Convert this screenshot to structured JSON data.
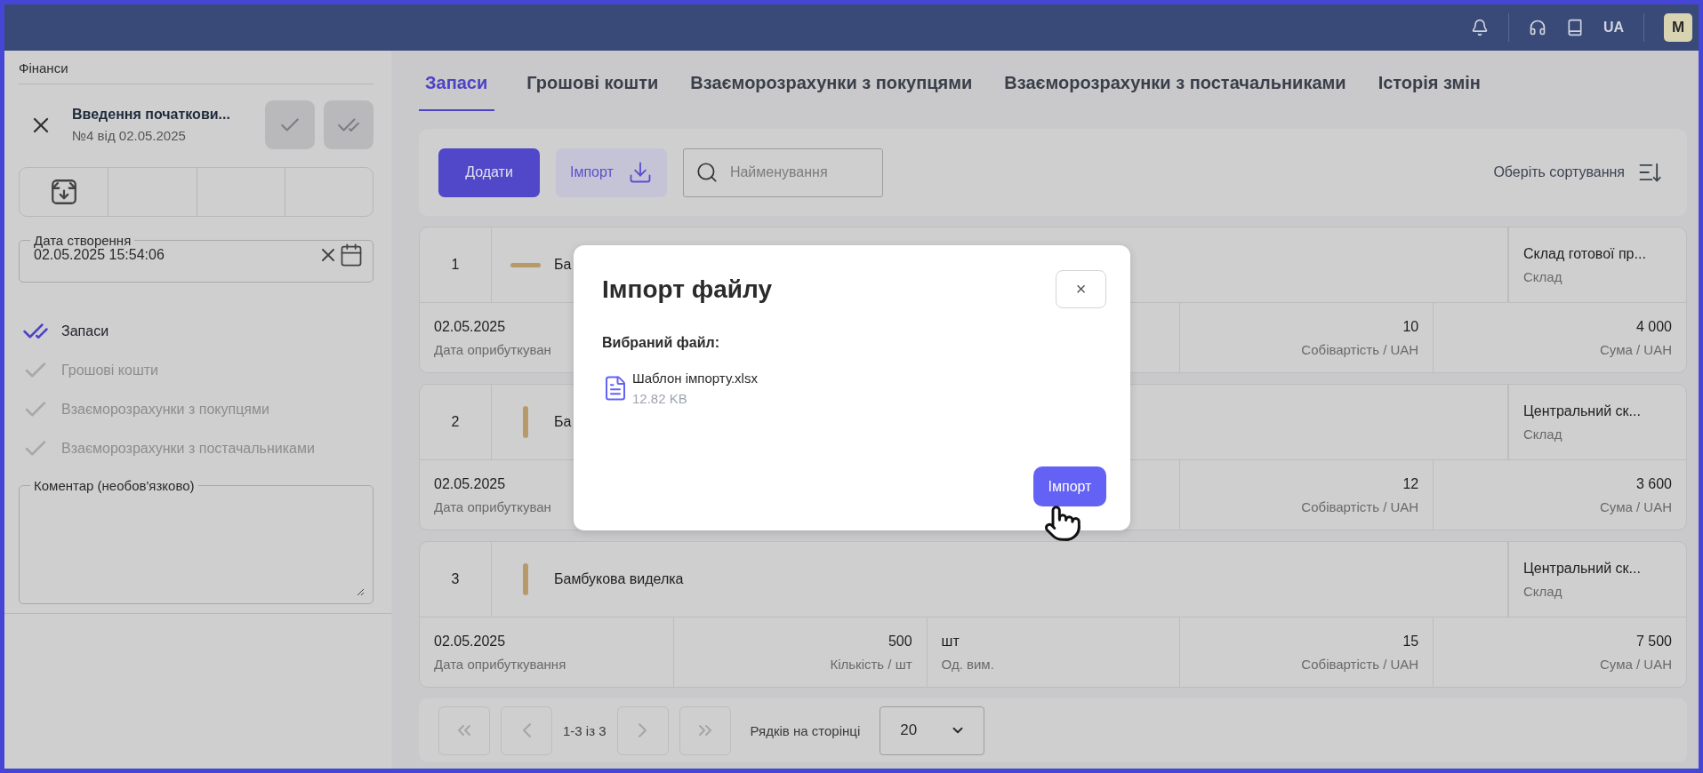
{
  "top_bar": {
    "language": "UA",
    "avatar": "M"
  },
  "sidebar": {
    "section": "Фінанси",
    "document": {
      "title": "Введення початкови...",
      "subtitle": "№4 від 02.05.2025"
    },
    "date_field": {
      "label": "Дата створення",
      "value": "02.05.2025 15:54:06"
    },
    "steps": [
      {
        "label": "Запаси",
        "selected": true
      },
      {
        "label": "Грошові кошти",
        "selected": false
      },
      {
        "label": "Взаєморозрахунки з покупцями",
        "selected": false
      },
      {
        "label": "Взаєморозрахунки з постачальниками",
        "selected": false
      }
    ],
    "comment_field": {
      "label": "Коментар (необов'язково)"
    }
  },
  "tabs": [
    {
      "label": "Запаси",
      "selected": true
    },
    {
      "label": "Грошові кошти",
      "selected": false
    },
    {
      "label": "Взаєморозрахунки з покупцями",
      "selected": false
    },
    {
      "label": "Взаєморозрахунки з постачальниками",
      "selected": false
    },
    {
      "label": "Історія змін",
      "selected": false
    }
  ],
  "toolbar": {
    "add_button": "Додати",
    "import_button": "Імпорт",
    "search": {
      "placeholder": "Найменування"
    },
    "sort": "Оберіть сортування"
  },
  "rows": [
    {
      "number": "1",
      "name": "Ба",
      "warehouse": "Склад готової пр...",
      "warehouse_label": "Склад",
      "date": "02.05.2025",
      "date_label": "Дата оприбуткуван",
      "cost": "10",
      "cost_label": "Собівартість / UAH",
      "sum": "4 000",
      "sum_label": "Сума / UAH"
    },
    {
      "number": "2",
      "name": "Ба",
      "warehouse": "Центральний ск...",
      "warehouse_label": "Склад",
      "date": "02.05.2025",
      "date_label": "Дата оприбуткуван",
      "cost": "12",
      "cost_label": "Собівартість / UAH",
      "sum": "3 600",
      "sum_label": "Сума / UAH"
    },
    {
      "number": "3",
      "name": "Бамбукова виделка",
      "warehouse": "Центральний ск...",
      "warehouse_label": "Склад",
      "date": "02.05.2025",
      "date_label": "Дата оприбуткування",
      "quantity": "500",
      "quantity_label": "Кількість / шт",
      "unit": "шт",
      "unit_label": "Од. вим.",
      "cost": "15",
      "cost_label": "Собівартість / UAH",
      "sum": "7 500",
      "sum_label": "Сума / UAH"
    }
  ],
  "pagination": {
    "range": "1-3 із 3",
    "rows_per_page_label": "Рядків на сторінці",
    "rows_per_page": "20"
  },
  "modal": {
    "title": "Імпорт файлу",
    "close": "×",
    "file_label": "Вибраний файл:",
    "file_name": "Шаблон імпорту.xlsx",
    "file_size": "12.82 KB",
    "import_button": "Імпорт"
  }
}
